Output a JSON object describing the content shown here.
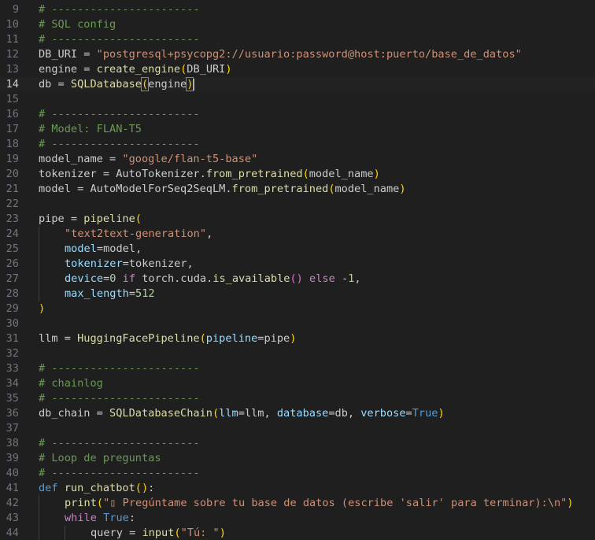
{
  "editor": {
    "language": "python",
    "current_line": 14,
    "colors": {
      "background": "#1f1f1f",
      "comment": "#6a9955",
      "string": "#ce9178",
      "keyword": "#c586c0",
      "function": "#dcdcaa",
      "parameter": "#9cdcfe",
      "constant": "#569cd6",
      "bracket_level1": "#ffd700",
      "bracket_level2": "#da70d6",
      "plain": "#cccccc",
      "line_number": "#6e7681",
      "line_number_active": "#cccccc"
    },
    "lines": [
      {
        "num": "9",
        "indent": 0,
        "tokens": [
          {
            "t": "comment",
            "v": "# -----------------------"
          }
        ]
      },
      {
        "num": "10",
        "indent": 0,
        "tokens": [
          {
            "t": "comment",
            "v": "# SQL config"
          }
        ]
      },
      {
        "num": "11",
        "indent": 0,
        "tokens": [
          {
            "t": "comment",
            "v": "# -----------------------"
          }
        ]
      },
      {
        "num": "12",
        "indent": 0,
        "tokens": [
          {
            "t": "plain",
            "v": "DB_URI = "
          },
          {
            "t": "string",
            "v": "\"postgresql+psycopg2://usuario:password@host:puerto/base_de_datos\""
          }
        ]
      },
      {
        "num": "13",
        "indent": 0,
        "tokens": [
          {
            "t": "plain",
            "v": "engine = "
          },
          {
            "t": "function",
            "v": "create_engine"
          },
          {
            "t": "bracket1",
            "v": "("
          },
          {
            "t": "plain",
            "v": "DB_URI"
          },
          {
            "t": "bracket1",
            "v": ")"
          }
        ]
      },
      {
        "num": "14",
        "indent": 0,
        "current": true,
        "tokens": [
          {
            "t": "plain",
            "v": "db = "
          },
          {
            "t": "function",
            "v": "SQLDatabase"
          },
          {
            "t": "bracket-match",
            "v": "("
          },
          {
            "t": "plain",
            "v": "engine"
          },
          {
            "t": "bracket-match",
            "v": ")"
          }
        ]
      },
      {
        "num": "15",
        "indent": 0,
        "tokens": []
      },
      {
        "num": "16",
        "indent": 0,
        "tokens": [
          {
            "t": "comment",
            "v": "# -----------------------"
          }
        ]
      },
      {
        "num": "17",
        "indent": 0,
        "tokens": [
          {
            "t": "comment",
            "v": "# Model: FLAN-T5"
          }
        ]
      },
      {
        "num": "18",
        "indent": 0,
        "tokens": [
          {
            "t": "comment",
            "v": "# -----------------------"
          }
        ]
      },
      {
        "num": "19",
        "indent": 0,
        "tokens": [
          {
            "t": "plain",
            "v": "model_name = "
          },
          {
            "t": "string",
            "v": "\"google/flan-t5-base\""
          }
        ]
      },
      {
        "num": "20",
        "indent": 0,
        "tokens": [
          {
            "t": "plain",
            "v": "tokenizer = "
          },
          {
            "t": "plain",
            "v": "AutoTokenizer."
          },
          {
            "t": "function",
            "v": "from_pretrained"
          },
          {
            "t": "bracket1",
            "v": "("
          },
          {
            "t": "plain",
            "v": "model_name"
          },
          {
            "t": "bracket1",
            "v": ")"
          }
        ]
      },
      {
        "num": "21",
        "indent": 0,
        "tokens": [
          {
            "t": "plain",
            "v": "model = "
          },
          {
            "t": "plain",
            "v": "AutoModelForSeq2SeqLM."
          },
          {
            "t": "function",
            "v": "from_pretrained"
          },
          {
            "t": "bracket1",
            "v": "("
          },
          {
            "t": "plain",
            "v": "model_name"
          },
          {
            "t": "bracket1",
            "v": ")"
          }
        ]
      },
      {
        "num": "22",
        "indent": 0,
        "tokens": []
      },
      {
        "num": "23",
        "indent": 0,
        "tokens": [
          {
            "t": "plain",
            "v": "pipe = "
          },
          {
            "t": "function",
            "v": "pipeline"
          },
          {
            "t": "bracket1",
            "v": "("
          }
        ]
      },
      {
        "num": "24",
        "indent": 1,
        "tokens": [
          {
            "t": "string",
            "v": "\"text2text-generation\""
          },
          {
            "t": "plain",
            "v": ","
          }
        ]
      },
      {
        "num": "25",
        "indent": 1,
        "tokens": [
          {
            "t": "param",
            "v": "model"
          },
          {
            "t": "plain",
            "v": "=model,"
          }
        ]
      },
      {
        "num": "26",
        "indent": 1,
        "tokens": [
          {
            "t": "param",
            "v": "tokenizer"
          },
          {
            "t": "plain",
            "v": "=tokenizer,"
          }
        ]
      },
      {
        "num": "27",
        "indent": 1,
        "tokens": [
          {
            "t": "param",
            "v": "device"
          },
          {
            "t": "plain",
            "v": "="
          },
          {
            "t": "number",
            "v": "0"
          },
          {
            "t": "plain",
            "v": " "
          },
          {
            "t": "keyword",
            "v": "if"
          },
          {
            "t": "plain",
            "v": " torch.cuda."
          },
          {
            "t": "function",
            "v": "is_available"
          },
          {
            "t": "bracket2",
            "v": "()"
          },
          {
            "t": "plain",
            "v": " "
          },
          {
            "t": "keyword",
            "v": "else"
          },
          {
            "t": "plain",
            "v": " -"
          },
          {
            "t": "number",
            "v": "1"
          },
          {
            "t": "plain",
            "v": ","
          }
        ]
      },
      {
        "num": "28",
        "indent": 1,
        "tokens": [
          {
            "t": "param",
            "v": "max_length"
          },
          {
            "t": "plain",
            "v": "="
          },
          {
            "t": "number",
            "v": "512"
          }
        ]
      },
      {
        "num": "29",
        "indent": 0,
        "tokens": [
          {
            "t": "bracket1",
            "v": ")"
          }
        ]
      },
      {
        "num": "30",
        "indent": 0,
        "tokens": []
      },
      {
        "num": "31",
        "indent": 0,
        "tokens": [
          {
            "t": "plain",
            "v": "llm = "
          },
          {
            "t": "function",
            "v": "HuggingFacePipeline"
          },
          {
            "t": "bracket1",
            "v": "("
          },
          {
            "t": "param",
            "v": "pipeline"
          },
          {
            "t": "plain",
            "v": "=pipe"
          },
          {
            "t": "bracket1",
            "v": ")"
          }
        ]
      },
      {
        "num": "32",
        "indent": 0,
        "tokens": []
      },
      {
        "num": "33",
        "indent": 0,
        "tokens": [
          {
            "t": "comment",
            "v": "# -----------------------"
          }
        ]
      },
      {
        "num": "34",
        "indent": 0,
        "tokens": [
          {
            "t": "comment",
            "v": "# chainlog"
          }
        ]
      },
      {
        "num": "35",
        "indent": 0,
        "tokens": [
          {
            "t": "comment",
            "v": "# -----------------------"
          }
        ]
      },
      {
        "num": "36",
        "indent": 0,
        "tokens": [
          {
            "t": "plain",
            "v": "db_chain = "
          },
          {
            "t": "function",
            "v": "SQLDatabaseChain"
          },
          {
            "t": "bracket1",
            "v": "("
          },
          {
            "t": "param",
            "v": "llm"
          },
          {
            "t": "plain",
            "v": "=llm, "
          },
          {
            "t": "param",
            "v": "database"
          },
          {
            "t": "plain",
            "v": "=db, "
          },
          {
            "t": "param",
            "v": "verbose"
          },
          {
            "t": "plain",
            "v": "="
          },
          {
            "t": "constant",
            "v": "True"
          },
          {
            "t": "bracket1",
            "v": ")"
          }
        ]
      },
      {
        "num": "37",
        "indent": 0,
        "tokens": []
      },
      {
        "num": "38",
        "indent": 0,
        "tokens": [
          {
            "t": "comment",
            "v": "# -----------------------"
          }
        ]
      },
      {
        "num": "39",
        "indent": 0,
        "tokens": [
          {
            "t": "comment",
            "v": "# Loop de preguntas"
          }
        ]
      },
      {
        "num": "40",
        "indent": 0,
        "tokens": [
          {
            "t": "comment",
            "v": "# -----------------------"
          }
        ]
      },
      {
        "num": "41",
        "indent": 0,
        "tokens": [
          {
            "t": "constant",
            "v": "def"
          },
          {
            "t": "plain",
            "v": " "
          },
          {
            "t": "function",
            "v": "run_chatbot"
          },
          {
            "t": "bracket1",
            "v": "()"
          },
          {
            "t": "plain",
            "v": ":"
          }
        ]
      },
      {
        "num": "42",
        "indent": 1,
        "tokens": [
          {
            "t": "function",
            "v": "print"
          },
          {
            "t": "bracket1",
            "v": "("
          },
          {
            "t": "string",
            "v": "\"▯ Pregúntame sobre tu base de datos (escribe 'salir' para terminar):\\n\""
          },
          {
            "t": "bracket1",
            "v": ")"
          }
        ]
      },
      {
        "num": "43",
        "indent": 1,
        "tokens": [
          {
            "t": "keyword",
            "v": "while"
          },
          {
            "t": "plain",
            "v": " "
          },
          {
            "t": "constant",
            "v": "True"
          },
          {
            "t": "plain",
            "v": ":"
          }
        ]
      },
      {
        "num": "44",
        "indent": 2,
        "tokens": [
          {
            "t": "plain",
            "v": "query = "
          },
          {
            "t": "function",
            "v": "input"
          },
          {
            "t": "bracket1",
            "v": "("
          },
          {
            "t": "string",
            "v": "\"Tú: \""
          },
          {
            "t": "bracket1",
            "v": ")"
          }
        ]
      }
    ]
  }
}
